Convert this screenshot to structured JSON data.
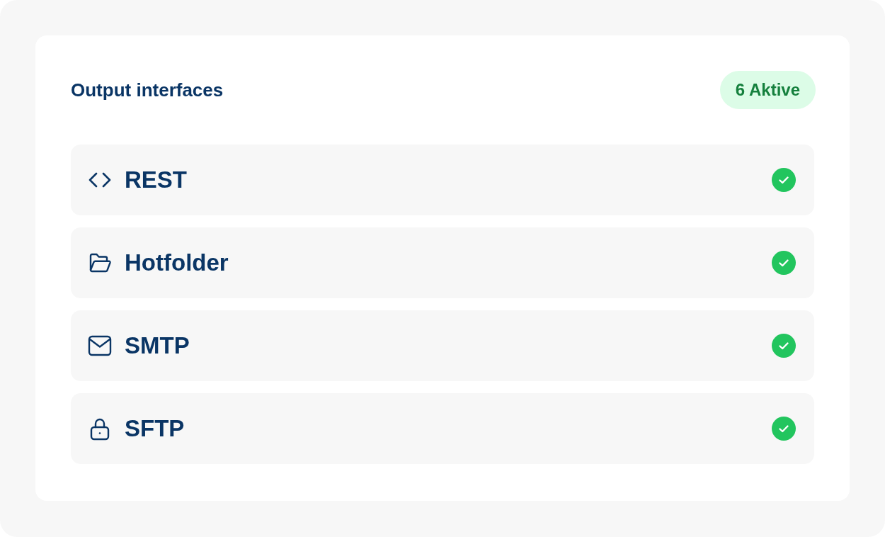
{
  "card": {
    "title": "Output interfaces",
    "badge": "6 Aktive"
  },
  "interfaces": [
    {
      "kind": "code",
      "name": "REST",
      "active": true
    },
    {
      "kind": "folder",
      "name": "Hotfolder",
      "active": true
    },
    {
      "kind": "mail",
      "name": "SMTP",
      "active": true
    },
    {
      "kind": "lock",
      "name": "SFTP",
      "active": true
    }
  ]
}
